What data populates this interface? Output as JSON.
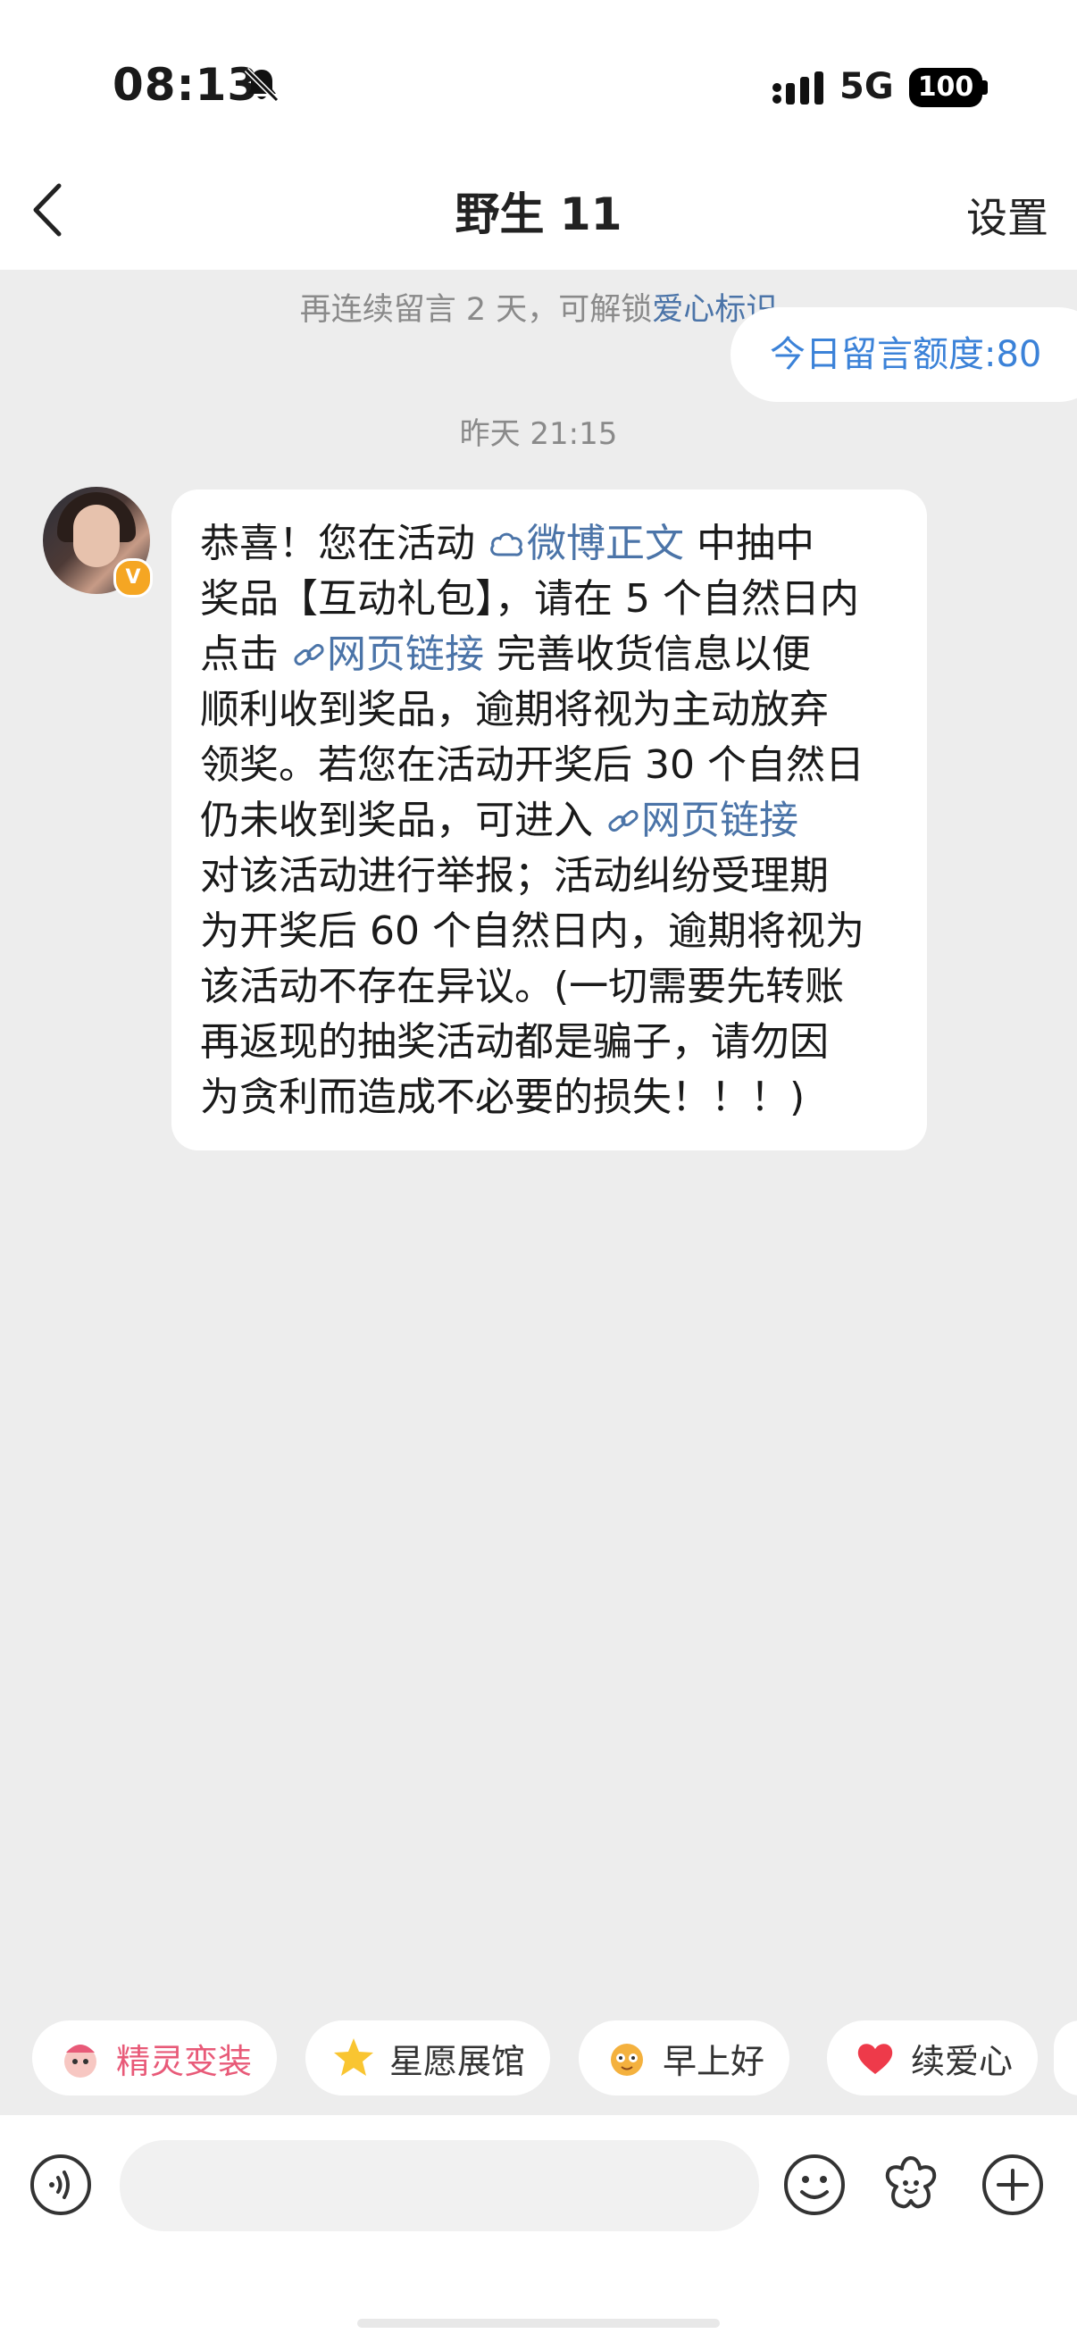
{
  "status_bar": {
    "time": "08:13",
    "network": "5G",
    "battery": "100"
  },
  "header": {
    "title": "野生 11",
    "settings_label": "设置"
  },
  "notice": {
    "prefix": "再连续留言 2 天，可解锁",
    "highlight": "爱心标识"
  },
  "quota": {
    "label": "今日留言额度:80"
  },
  "timestamp": "昨天 21:15",
  "message": {
    "line1_a": "恭喜！您在活动 ",
    "line1_link": "微博正文",
    "line1_b": " 中抽中",
    "line2": "奖品【互动礼包】，请在 5 个自然日内",
    "line3_a": "点击 ",
    "line3_link": "网页链接",
    "line3_b": " 完善收货信息以便",
    "line4": "顺利收到奖品，逾期将视为主动放弃",
    "line5": "领奖。若您在活动开奖后 30 个自然日",
    "line6_a": "仍未收到奖品，可进入 ",
    "line6_link": "网页链接",
    "line7": "对该活动进行举报；活动纠纷受理期",
    "line8": "为开奖后 60 个自然日内，逾期将视为",
    "line9": "该活动不存在异议。(一切需要先转账",
    "line10": "再返现的抽奖活动都是骗子，请勿因",
    "line11": "为贪利而造成不必要的损失！！！)"
  },
  "quick_replies": [
    {
      "label": "精灵变装",
      "icon": "sprite-icon"
    },
    {
      "label": "星愿展馆",
      "icon": "star-icon"
    },
    {
      "label": "早上好",
      "icon": "morning-icon"
    },
    {
      "label": "续爱心",
      "icon": "heart-icon"
    }
  ],
  "colors": {
    "link": "#4b74a8",
    "quota_text": "#3b82d8",
    "background": "#ededed",
    "verified_badge": "#f5a623"
  }
}
